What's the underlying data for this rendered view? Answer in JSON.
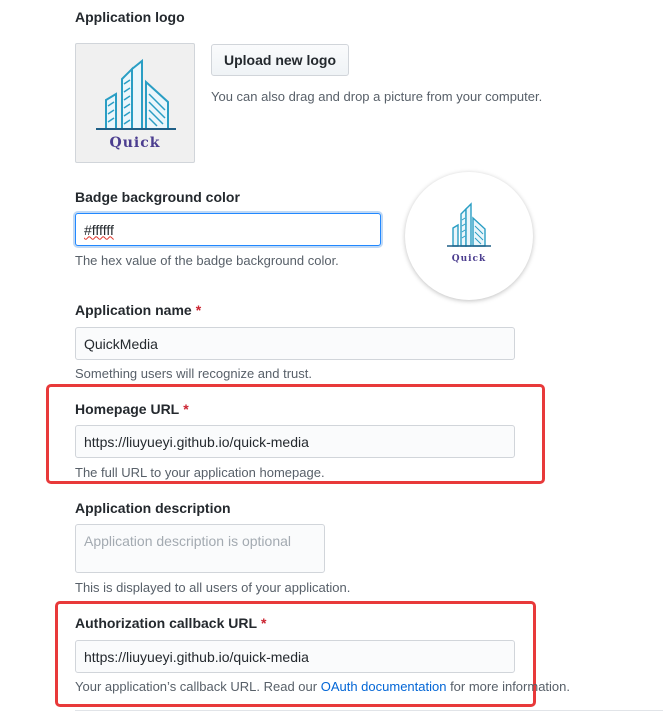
{
  "logo": {
    "label": "Application logo",
    "image_text": "Quick",
    "upload_button": "Upload new logo",
    "drag_hint": "You can also drag and drop a picture from your computer."
  },
  "badge": {
    "label": "Badge background color",
    "value": "#ffffff",
    "note": "The hex value of the badge background color.",
    "preview_text": "Quick"
  },
  "app_name": {
    "label": "Application name",
    "required_mark": "*",
    "value": "QuickMedia",
    "note": "Something users will recognize and trust."
  },
  "homepage": {
    "label": "Homepage URL",
    "required_mark": "*",
    "value": "https://liuyueyi.github.io/quick-media",
    "note": "The full URL to your application homepage."
  },
  "description": {
    "label": "Application description",
    "placeholder": "Application description is optional",
    "note": "This is displayed to all users of your application."
  },
  "callback": {
    "label": "Authorization callback URL",
    "required_mark": "*",
    "value": "https://liuyueyi.github.io/quick-media",
    "note_prefix": "Your application’s callback URL. Read our ",
    "note_link": "OAuth documentation",
    "note_suffix": " for more information."
  },
  "colors": {
    "highlight": "#e8393a",
    "focus": "#2188ff",
    "link": "#0366d6",
    "required": "#cb2431",
    "logo_teal": "#2a9ec4",
    "logo_purple": "#4b3d8f"
  }
}
